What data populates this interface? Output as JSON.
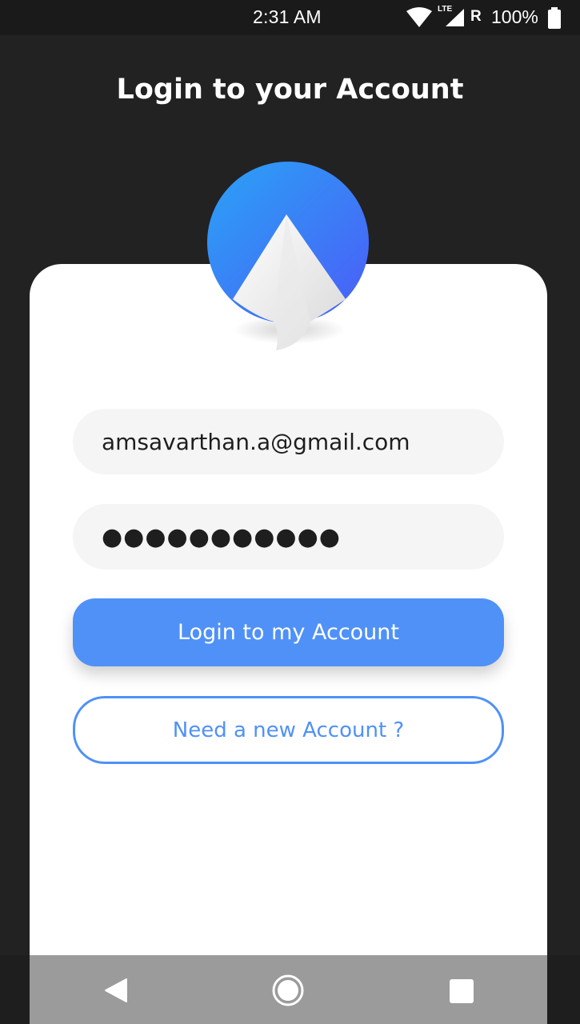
{
  "status_bar": {
    "time": "2:31 AM",
    "network_type": "LTE",
    "roaming": "R",
    "battery": "100%",
    "icons": [
      "wifi-icon",
      "cell-signal-icon",
      "battery-icon"
    ]
  },
  "header": {
    "title": "Login to your Account"
  },
  "logo": {
    "icon": "app-logo-icon",
    "colors": [
      "#2f9bf6",
      "#4c63f7"
    ]
  },
  "form": {
    "email_value": "amsavarthan.a@gmail.com",
    "password_value": "●●●●●●●●●●●"
  },
  "buttons": {
    "login_label": "Login to my Account",
    "register_label": "Need a new Account ?"
  },
  "navigation": {
    "icons": [
      "back-icon",
      "home-icon",
      "recents-icon"
    ]
  },
  "colors": {
    "accent": "#4f91f7",
    "background": "#222222",
    "card": "#ffffff"
  }
}
